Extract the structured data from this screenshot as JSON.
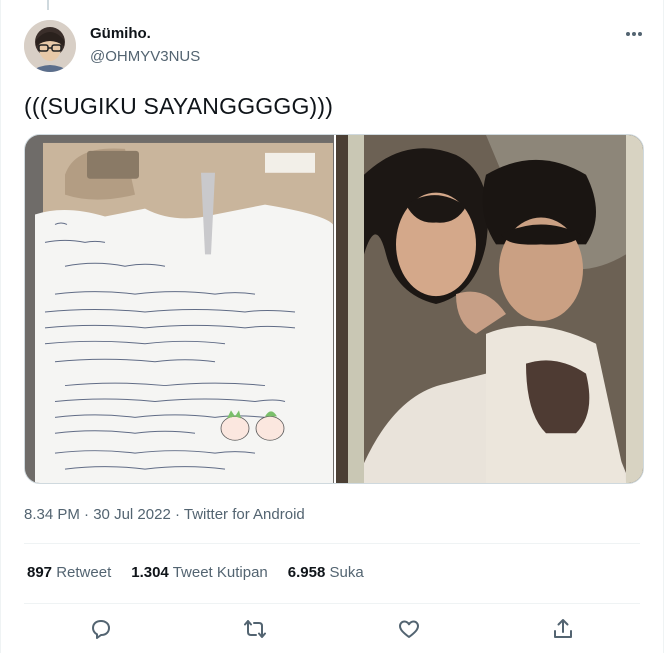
{
  "author": {
    "name": "Gümiho.",
    "handle": "@OHMYV3NUS"
  },
  "tweet": {
    "text": "(((SUGIKU SAYANGGGGG)))"
  },
  "media": [
    {
      "icon": "letter-photo"
    },
    {
      "icon": "couple-photo"
    }
  ],
  "meta": {
    "time": "8.34 PM",
    "separator1": " · ",
    "date": "30 Jul 2022",
    "separator2": " · ",
    "source": "Twitter for Android"
  },
  "stats": {
    "retweets": {
      "value": "897",
      "label": "Retweet"
    },
    "quotes": {
      "value": "1.304",
      "label": "Tweet Kutipan"
    },
    "likes": {
      "value": "6.958",
      "label": "Suka"
    }
  },
  "colors": {
    "text_primary": "#0f1419",
    "text_secondary": "#536471",
    "border": "#eff3f4"
  }
}
